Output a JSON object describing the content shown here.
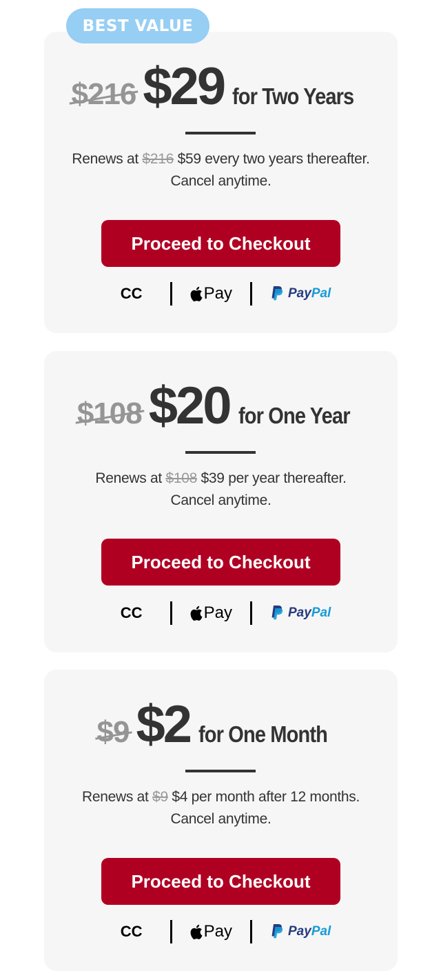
{
  "badge": "BEST VALUE",
  "plans": [
    {
      "original_price": "$216",
      "price": "$29",
      "term": "for Two Years",
      "renew_prefix": "Renews at",
      "renew_old": "$216",
      "renew_rest": "$59 every two years thereafter.",
      "cancel": "Cancel anytime.",
      "cta": "Proceed to Checkout"
    },
    {
      "original_price": "$108",
      "price": "$20",
      "term": "for One Year",
      "renew_prefix": "Renews at",
      "renew_old": "$108",
      "renew_rest": "$39 per year thereafter.",
      "cancel": "Cancel anytime.",
      "cta": "Proceed to Checkout"
    },
    {
      "original_price": "$9",
      "price": "$2",
      "term": "for One Month",
      "renew_prefix": "Renews at",
      "renew_old": "$9",
      "renew_rest": "$4 per month after 12 months.",
      "cancel": "Cancel anytime.",
      "cta": "Proceed to Checkout"
    }
  ],
  "payment_methods": {
    "cc": "CC",
    "apple_pay": "Pay",
    "paypal_a": "Pay",
    "paypal_b": "Pal"
  },
  "colors": {
    "badge": "#97cef3",
    "cta": "#b00022",
    "card_bg": "#f6f6f6",
    "text": "#333333",
    "strike": "#959595",
    "paypal_dark": "#253b80",
    "paypal_light": "#179bd7"
  }
}
